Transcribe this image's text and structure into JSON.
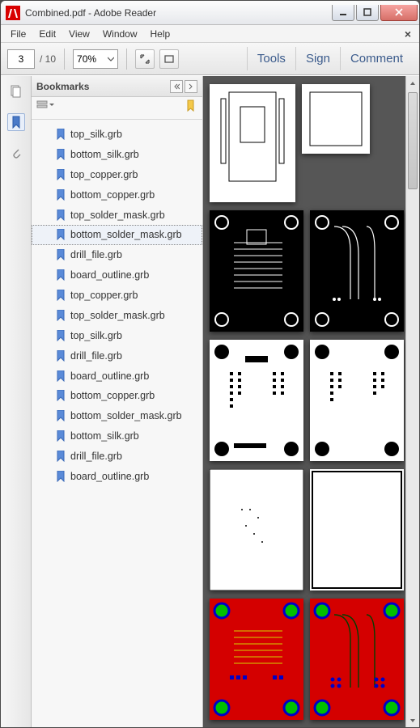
{
  "window": {
    "title": "Combined.pdf - Adobe Reader"
  },
  "menubar": {
    "items": [
      "File",
      "Edit",
      "View",
      "Window",
      "Help"
    ]
  },
  "toolbar": {
    "current_page": "3",
    "total_pages": "/ 10",
    "zoom": "70%"
  },
  "right_tabs": {
    "tools": "Tools",
    "sign": "Sign",
    "comment": "Comment"
  },
  "bookmarks": {
    "title": "Bookmarks",
    "items": [
      "top_silk.grb",
      "bottom_silk.grb",
      "top_copper.grb",
      "bottom_copper.grb",
      "top_solder_mask.grb",
      "bottom_solder_mask.grb",
      "drill_file.grb",
      "board_outline.grb",
      "top_copper.grb",
      "top_solder_mask.grb",
      "top_silk.grb",
      "drill_file.grb",
      "board_outline.grb",
      "bottom_copper.grb",
      "bottom_solder_mask.grb",
      "bottom_silk.grb",
      "drill_file.grb",
      "board_outline.grb"
    ],
    "selected_index": 5
  }
}
